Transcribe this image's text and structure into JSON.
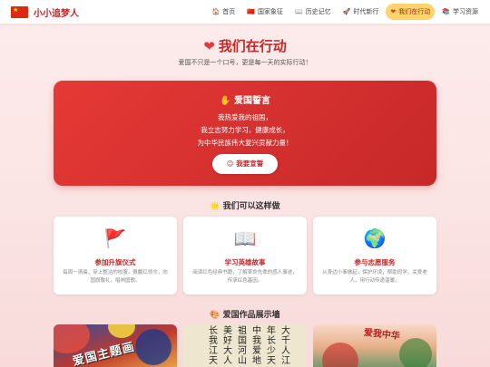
{
  "nav": {
    "brand": "小小追梦人",
    "items": [
      {
        "icon": "🏠",
        "label": "首页",
        "icon_name": "home-icon"
      },
      {
        "icon": "🇨🇳",
        "label": "国家象征",
        "icon_name": "flag-icon"
      },
      {
        "icon": "📖",
        "label": "历史记忆",
        "icon_name": "book-icon"
      },
      {
        "icon": "🚀",
        "label": "时代新行",
        "icon_name": "rocket-icon"
      },
      {
        "icon": "❤",
        "label": "我们在行动",
        "icon_name": "heart-icon",
        "active": true
      },
      {
        "icon": "📚",
        "label": "学习资源",
        "icon_name": "books-icon"
      }
    ]
  },
  "hero": {
    "icon": "❤",
    "title": "我们在行动",
    "subtitle": "爱国不只是一个口号，更是每一天的实际行动！"
  },
  "pledge": {
    "icon": "✋",
    "title": "爱国誓言",
    "lines": [
      "我热爱我的祖国，",
      "我立志努力学习，健康成长，",
      "为中华民族伟大复兴贡献力量！"
    ],
    "button_icon": "😊",
    "button_label": "我要宣誓"
  },
  "actions": {
    "icon": "🌟",
    "title": "我们可以这样做",
    "cards": [
      {
        "icon": "🚩",
        "icon_name": "red-flag-icon",
        "title": "参加升旗仪式",
        "desc": "每周一清晨，穿上整洁的校服，佩戴红领巾，向国旗敬礼，唱响国歌。"
      },
      {
        "icon": "📖",
        "icon_name": "open-book-icon",
        "title": "学习英雄故事",
        "desc": "阅读红色经典书籍，了解革命先辈的感人事迹，传承红色基因。"
      },
      {
        "icon": "🌍",
        "icon_name": "globe-icon",
        "title": "参与志愿服务",
        "desc": "从身边小事做起，保护环境，帮助同学，关爱老人，用行动传递温暖。"
      }
    ]
  },
  "gallery": {
    "icon": "🎨",
    "title": "爱国作品展示墙",
    "thumb1_text": "爱国主题画",
    "thumb2_chars": [
      "大",
      "千",
      "人",
      "江",
      "年",
      "长",
      "少",
      "天",
      "中",
      "我",
      "爱",
      "地",
      "祖",
      "国",
      "河",
      "山",
      "美",
      "好"
    ],
    "thumb3_text": "爱我中华"
  },
  "colors": {
    "accent": "#c62828",
    "pledge_bg": "#d32f2f",
    "active_nav": "#ffd36b"
  }
}
